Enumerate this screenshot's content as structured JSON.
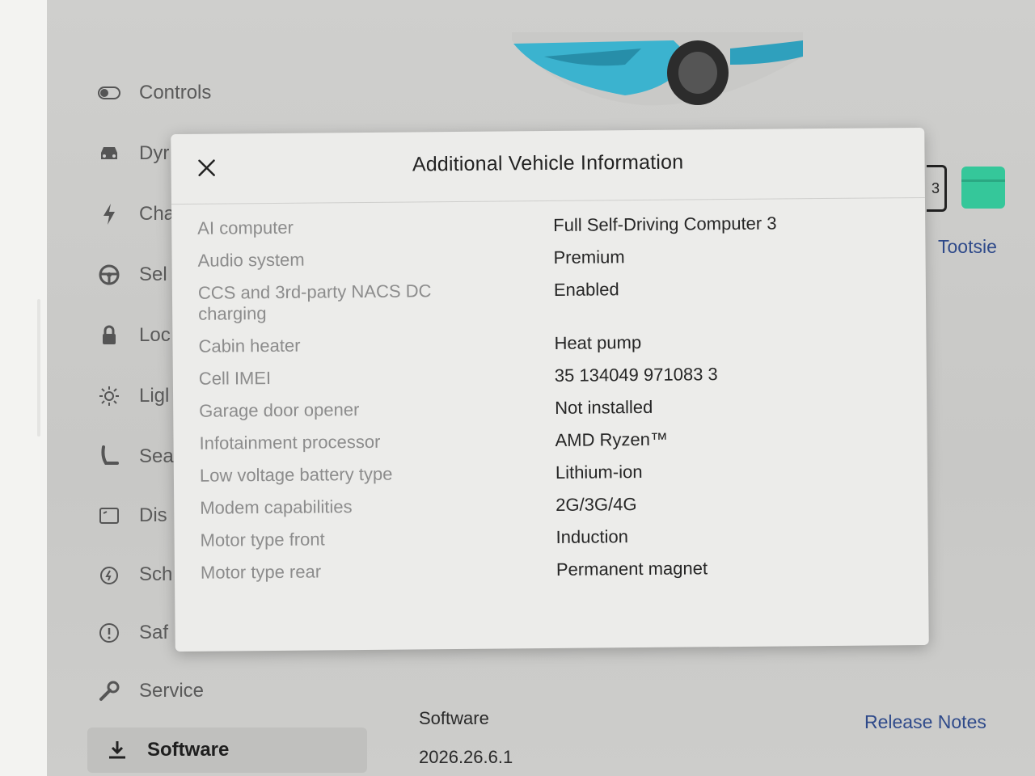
{
  "sidebar": {
    "items": [
      {
        "label": "Controls",
        "icon": "toggle-icon"
      },
      {
        "label": "Dyr",
        "icon": "car-icon"
      },
      {
        "label": "Cha",
        "icon": "bolt-icon"
      },
      {
        "label": "Sel",
        "icon": "steering-wheel-icon"
      },
      {
        "label": "Loc",
        "icon": "lock-icon"
      },
      {
        "label": "Ligl",
        "icon": "sun-icon"
      },
      {
        "label": "Sea",
        "icon": "seat-icon"
      },
      {
        "label": "Dis",
        "icon": "display-icon"
      },
      {
        "label": "Sch",
        "icon": "clock-bolt-icon"
      },
      {
        "label": "Saf",
        "icon": "alert-circle-icon"
      },
      {
        "label": "Service",
        "icon": "wrench-icon"
      },
      {
        "label": "Software",
        "icon": "download-icon",
        "active": true
      }
    ]
  },
  "vehicle": {
    "name": "Tootsie",
    "badge_number": "3",
    "swatch_color": "#35c79a"
  },
  "software": {
    "label": "Software",
    "version": "2026.26.6.1",
    "release_notes": "Release Notes"
  },
  "modal": {
    "title": "Additional Vehicle Information",
    "rows": [
      {
        "key": "AI computer",
        "value": "Full Self-Driving Computer 3"
      },
      {
        "key": "Audio system",
        "value": "Premium"
      },
      {
        "key": "CCS and 3rd-party NACS DC charging",
        "value": "Enabled"
      },
      {
        "key": "Cabin heater",
        "value": "Heat pump"
      },
      {
        "key": "Cell IMEI",
        "value": "35 134049 971083 3"
      },
      {
        "key": "Garage door opener",
        "value": "Not installed"
      },
      {
        "key": "Infotainment processor",
        "value": "AMD Ryzen™"
      },
      {
        "key": "Low voltage battery type",
        "value": "Lithium-ion"
      },
      {
        "key": "Modem capabilities",
        "value": "2G/3G/4G"
      },
      {
        "key": "Motor type front",
        "value": "Induction"
      },
      {
        "key": "Motor type rear",
        "value": "Permanent magnet"
      }
    ]
  }
}
